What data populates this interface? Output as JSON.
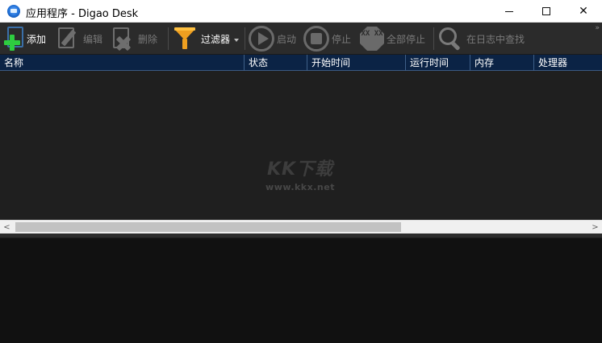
{
  "window": {
    "title": "应用程序 - Digao Desk",
    "controls": {
      "minimize": "minimize-icon",
      "maximize": "maximize-icon",
      "close": "✕"
    }
  },
  "toolbar": {
    "add_label": "添加",
    "edit_label": "编辑",
    "delete_label": "删除",
    "filter_label": "过滤器",
    "start_label": "启动",
    "stop_label": "停止",
    "stop_all_label": "全部停止",
    "stop_all_icon_text": "XX XX",
    "search_log_label": "在日志中查找",
    "more_label": "»"
  },
  "table": {
    "columns": [
      "名称",
      "状态",
      "开始时间",
      "运行时间",
      "内存",
      "处理器"
    ],
    "rows": []
  },
  "watermark": {
    "line1": "KK下载",
    "line2": "www.kkx.net"
  },
  "scrollbar": {
    "left_arrow": "<",
    "right_arrow": ">"
  },
  "colors": {
    "toolbar_bg": "#2b2b2b",
    "header_bg": "#0b2345",
    "list_bg": "#1f1f1f",
    "log_bg": "#111111",
    "add_green": "#2ecc40",
    "filter_orange": "#f0a020"
  }
}
